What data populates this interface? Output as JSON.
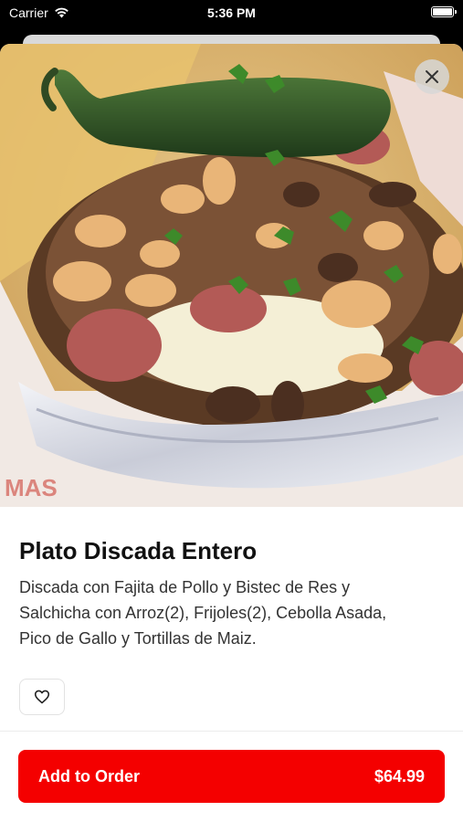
{
  "status_bar": {
    "carrier": "Carrier",
    "time": "5:36 PM",
    "battery_level": 1.0
  },
  "item": {
    "title": "Plato Discada Entero",
    "description": "Discada con Fajita de Pollo y Bistec de Res y\nSalchicha con Arroz(2), Frijoles(2), Cebolla Asada,\nPico de Gallo y Tortillas de Maiz.",
    "image_icon": "food-photo"
  },
  "actions": {
    "close_icon": "close-icon",
    "favorite_icon": "heart-outline-icon",
    "add_to_order_label": "Add to Order",
    "price": "$64.99"
  },
  "colors": {
    "accent": "#f40000",
    "text_primary": "#111111",
    "text_secondary": "#333333"
  }
}
